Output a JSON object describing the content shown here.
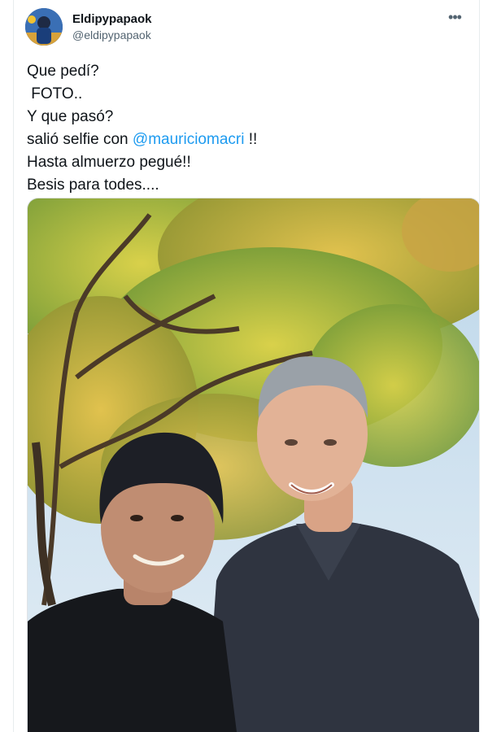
{
  "tweet": {
    "display_name": "Eldipypapaok",
    "handle": "@eldipypapaok",
    "more_icon": "more-horizontal-icon",
    "text": {
      "line1": "Que pedí?",
      "line2": " FOTO..",
      "line3": "Y que pasó?",
      "line4_prefix": "salió selfie con ",
      "line4_mention": "@mauriciomacri",
      "line4_suffix": " !!",
      "line5": "Hasta almuerzo pegué!!",
      "line6": "Besis para todes...."
    },
    "colors": {
      "text": "#0f1419",
      "secondary": "#536471",
      "mention": "#1d9bf0"
    }
  }
}
